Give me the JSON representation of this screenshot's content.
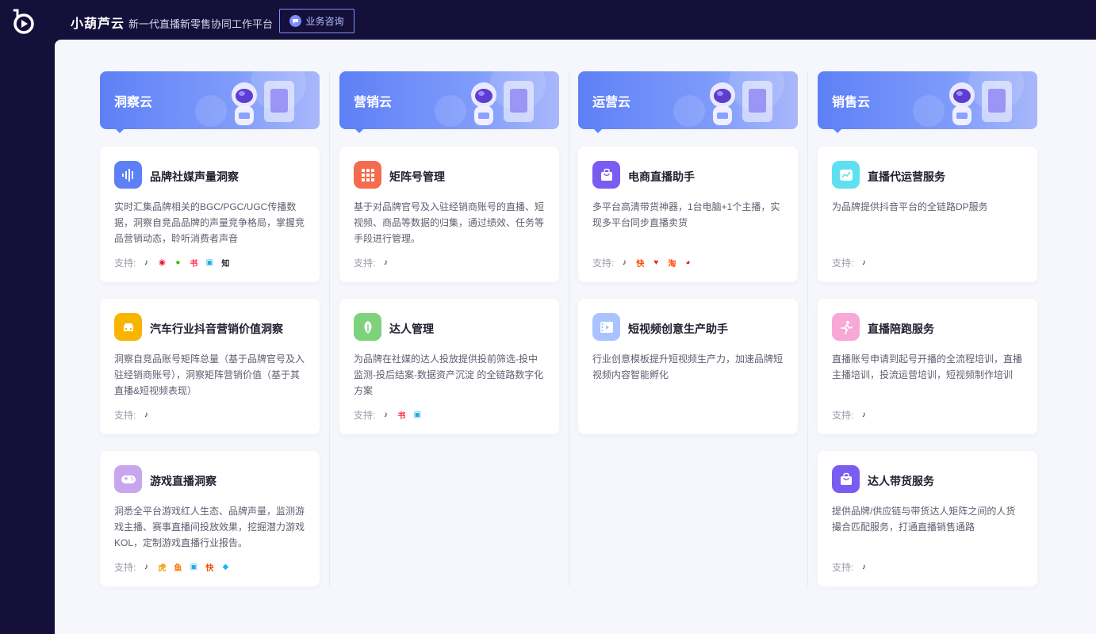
{
  "header": {
    "brand": "小葫芦云",
    "slogan": "新一代直播新零售协同工作平台",
    "consult_label": "业务咨询"
  },
  "support_label": "支持:",
  "colors": {
    "accent": "#5e80f6",
    "dark_bg": "#14103a",
    "page_bg": "#f5f7fc"
  },
  "columns": [
    {
      "title": "洞察云",
      "cards": [
        {
          "title": "品牌社媒声量洞察",
          "icon": "soundwave-icon",
          "icon_color": "#5e80f6",
          "desc": "实时汇集品牌相关的BGC/PGC/UGC传播数据，洞察自竞品品牌的声量竞争格局，掌握竞品营销动态，聆听消费者声音",
          "platforms": [
            "douyin-icon",
            "weibo-icon",
            "wechat-icon",
            "xiaohongshu-icon",
            "bilibili-icon",
            "zhihu-icon"
          ]
        },
        {
          "title": "汽车行业抖音营销价值洞察",
          "icon": "car-icon",
          "icon_color": "#f8b500",
          "desc": "洞察自竞品账号矩阵总量（基于品牌官号及入驻经销商账号），洞察矩阵营销价值（基于其直播&短视频表现）",
          "platforms": [
            "douyin-icon"
          ]
        },
        {
          "title": "游戏直播洞察",
          "icon": "gamepad-icon",
          "icon_color": "#c8a6ee",
          "desc": "洞悉全平台游戏红人生态、品牌声量，监测游戏主播、赛事直播间投放效果，挖掘潜力游戏KOL，定制游戏直播行业报告。",
          "platforms": [
            "douyin-icon",
            "huya-icon",
            "douyu-icon",
            "bilibili-icon",
            "kuaishou-icon",
            "egame-icon"
          ]
        }
      ]
    },
    {
      "title": "营销云",
      "cards": [
        {
          "title": "矩阵号管理",
          "icon": "grid-icon",
          "icon_color": "#f46b4d",
          "desc": "基于对品牌官号及入驻经销商账号的直播、短视频、商品等数据的归集，通过绩效、任务等手段进行管理。",
          "platforms": [
            "douyin-icon"
          ]
        },
        {
          "title": "达人管理",
          "icon": "leaf-icon",
          "icon_color": "#7ed27b",
          "desc": "为品牌在社媒的达人投放提供投前筛选-投中监测-投后结案-数据资产沉淀 的全链路数字化方案",
          "platforms": [
            "douyin-icon",
            "xiaohongshu-icon",
            "bilibili-icon"
          ]
        }
      ]
    },
    {
      "title": "运营云",
      "cards": [
        {
          "title": "电商直播助手",
          "icon": "shopping-bag-icon",
          "icon_color": "#7b5cf0",
          "desc": "多平台高清带货神器，1台电脑+1个主播，实现多平台同步直播卖货",
          "platforms": [
            "douyin-icon",
            "kuaishou-icon",
            "pinduoduo-icon",
            "taobao-icon",
            "jd-icon"
          ]
        },
        {
          "title": "短视频创意生产助手",
          "icon": "video-icon",
          "icon_color": "#a9c3ff",
          "desc": "行业创意模板提升短视频生产力，加速品牌短视频内容智能孵化",
          "platforms": []
        }
      ]
    },
    {
      "title": "销售云",
      "cards": [
        {
          "title": "直播代运营服务",
          "icon": "trend-chart-icon",
          "icon_color": "#5fe0f0",
          "desc": "为品牌提供抖音平台的全链路DP服务",
          "platforms": [
            "douyin-icon"
          ]
        },
        {
          "title": "直播陪跑服务",
          "icon": "runner-icon",
          "icon_color": "#f7a8d6",
          "desc": "直播账号申请到起号开播的全流程培训，直播主播培训，投流运营培训，短视频制作培训",
          "platforms": [
            "douyin-icon"
          ]
        },
        {
          "title": "达人带货服务",
          "icon": "shopping-bag-icon",
          "icon_color": "#7b5cf0",
          "desc": "提供品牌/供应链与带货达人矩阵之间的人货撮合匹配服务，打通直播销售通路",
          "platforms": [
            "douyin-icon"
          ]
        }
      ]
    }
  ]
}
